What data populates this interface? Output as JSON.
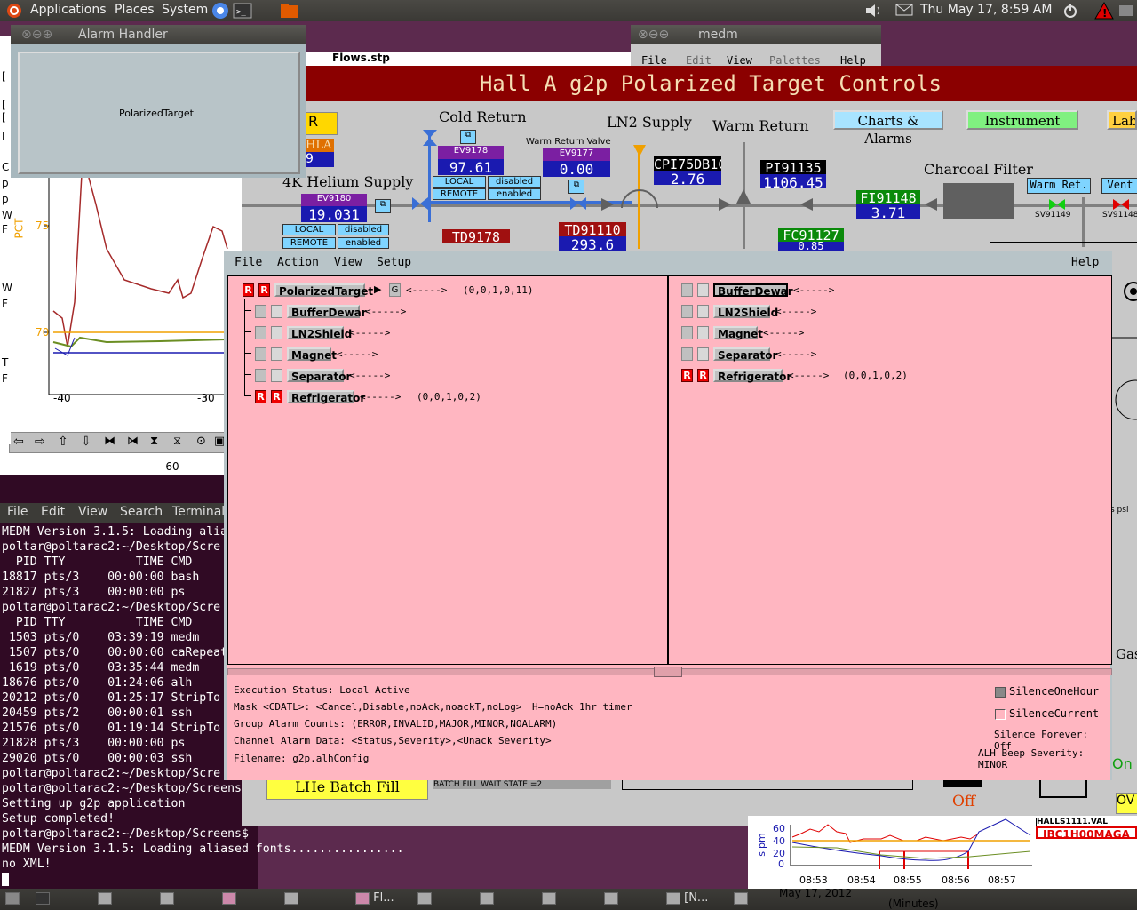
{
  "top_panel": {
    "applications": "Applications",
    "places": "Places",
    "system": "System",
    "datetime": "Thu May 17,  8:59 AM"
  },
  "taskbar": {
    "item_fl": "Fl...",
    "item_n": "[N..."
  },
  "strip_left": {
    "ylabel": "PCT",
    "y75": "75",
    "y70": "70",
    "xm40": "-40",
    "xm30": "-30",
    "xm60": "-60",
    "side_letters": [
      "[",
      "[",
      "[",
      "l",
      "C",
      "p",
      "p",
      "W",
      "F",
      "W",
      "F",
      "T",
      "F"
    ]
  },
  "terminal": {
    "menu": [
      "File",
      "Edit",
      "View",
      "Search",
      "Terminal"
    ],
    "lines": [
      "MEDM Version 3.1.5: Loading alia",
      "poltar@poltarac2:~/Desktop/Scre",
      "  PID TTY          TIME CMD",
      "18817 pts/3    00:00:00 bash",
      "21827 pts/3    00:00:00 ps",
      "poltar@poltarac2:~/Desktop/Scre",
      "  PID TTY          TIME CMD",
      " 1503 pts/0    03:39:19 medm",
      " 1507 pts/0    00:00:00 caRepeat",
      " 1619 pts/0    03:35:44 medm",
      "18676 pts/0    01:24:06 alh",
      "20212 pts/0    01:25:17 StripTo",
      "20459 pts/2    00:00:01 ssh",
      "21576 pts/0    01:19:14 StripTo",
      "21828 pts/3    00:00:00 ps",
      "29020 pts/0    00:00:03 ssh",
      "poltar@poltarac2:~/Desktop/Scre",
      "poltar@poltarac2:~/Desktop/Screens",
      "Setting up g2p application",
      "Setup completed!",
      "poltar@poltarac2:~/Desktop/Screens$",
      "MEDM Version 3.1.5: Loading aliased fonts................",
      "no XML!"
    ]
  },
  "alarm_small": {
    "title": "Alarm Handler",
    "group": "PolarizedTarget"
  },
  "medm": {
    "window_title": "medm",
    "menu": [
      "File",
      "Edit",
      "View",
      "Palettes",
      "Help"
    ],
    "strip_title": "Flows.stp",
    "title": "Hall A g2p Polarized Target Controls",
    "cold_return": "Cold Return",
    "ln2_supply": "LN2 Supply",
    "warm_return": "Warm Return",
    "warm_return_valve": "Warm Return Valve",
    "charcoal_filter": "Charcoal Filter",
    "helium_supply": "4K Helium Supply",
    "nav_charts": "Charts & Alarms",
    "nav_instrument": "Instrument Cont",
    "nav_lab": "LabV",
    "r_button": "R",
    "hla_label": "HLA",
    "hla_value": "9",
    "ev9178_name": "EV9178",
    "ev9178_value": "97.61",
    "ev9177_name": "EV9177",
    "ev9177_value": "0.00",
    "ev9180_name": "EV9180",
    "ev9180_value": "19.031",
    "local": "LOCAL",
    "remote": "REMOTE",
    "disabled": "disabled",
    "enabled": "enabled",
    "cpi": "CPI75DB1C",
    "cpi_value": "2.76",
    "pi91135": "PI91135",
    "pi91135_value": "1106.45",
    "fi91148": "FI91148",
    "fi91148_value": "3.71",
    "fc91127": "FC91127",
    "fc91127_value": "0.85",
    "td9178": "TD9178",
    "td91110": "TD91110",
    "td91110_value": "293.6",
    "warm_ret_btn": "Warm Ret.",
    "vent_btn": "Vent",
    "sv91149": "SV91149",
    "sv91148": "SV91148",
    "lhe_batch": "LHe Batch Fill",
    "batch_state": "BATCH FILL WAIT STATE =2",
    "off": "Off",
    "on": "On",
    "gas": "Gas",
    "psi": "s psi",
    "ov": "OV"
  },
  "alarm_handler": {
    "menu": [
      "File",
      "Action",
      "View",
      "Setup"
    ],
    "help": "Help",
    "left_tree": [
      {
        "name": "PolarizedTarget",
        "counts": "(0,0,1,0,11)",
        "alarm": true,
        "top": true
      },
      {
        "name": "BufferDewar",
        "counts": "",
        "alarm": false
      },
      {
        "name": "LN2Shield",
        "counts": "",
        "alarm": false
      },
      {
        "name": "Magnet",
        "counts": "",
        "alarm": false
      },
      {
        "name": "Separator",
        "counts": "",
        "alarm": false
      },
      {
        "name": "Refrigerator",
        "counts": "(0,0,1,0,2)",
        "alarm": true
      }
    ],
    "right_list": [
      {
        "name": "BufferDewar",
        "counts": "",
        "alarm": false
      },
      {
        "name": "LN2Shield",
        "counts": "",
        "alarm": false
      },
      {
        "name": "Magnet",
        "counts": "",
        "alarm": false
      },
      {
        "name": "Separator",
        "counts": "",
        "alarm": false
      },
      {
        "name": "Refrigerator",
        "counts": "(0,0,1,0,2)",
        "alarm": true
      }
    ],
    "arrow": "<----->",
    "g_button": "G",
    "execution_status": "Execution Status:  Local Active",
    "mask": "Mask <CDATL>:  <Cancel,Disable,noAck,noackT,noLog>",
    "mask_hint": "H=noAck 1hr timer",
    "group_counts": "Group Alarm Counts:  (ERROR,INVALID,MAJOR,MINOR,NOALARM)",
    "channel_data": "Channel Alarm Data:  <Status,Severity>,<Unack Severity>",
    "filename": "Filename:   g2p.alhConfig",
    "silence_one_hour": "SilenceOneHour",
    "silence_current": "SilenceCurrent",
    "silence_forever": "Silence Forever:  Off",
    "beep_severity": "ALH Beep Severity: MINOR",
    "r_label": "R"
  },
  "chart2": {
    "ylabel": "slpm",
    "y60": "60",
    "y40": "40",
    "y20": "20",
    "y0": "0",
    "times": [
      "08:53",
      "08:54",
      "08:55",
      "08:56",
      "08:57"
    ],
    "date": "May 17, 2012",
    "xlabel": "(Minutes)",
    "legend1": "HALLS1111.VAL",
    "legend2": "IBC1H00MAGA"
  }
}
